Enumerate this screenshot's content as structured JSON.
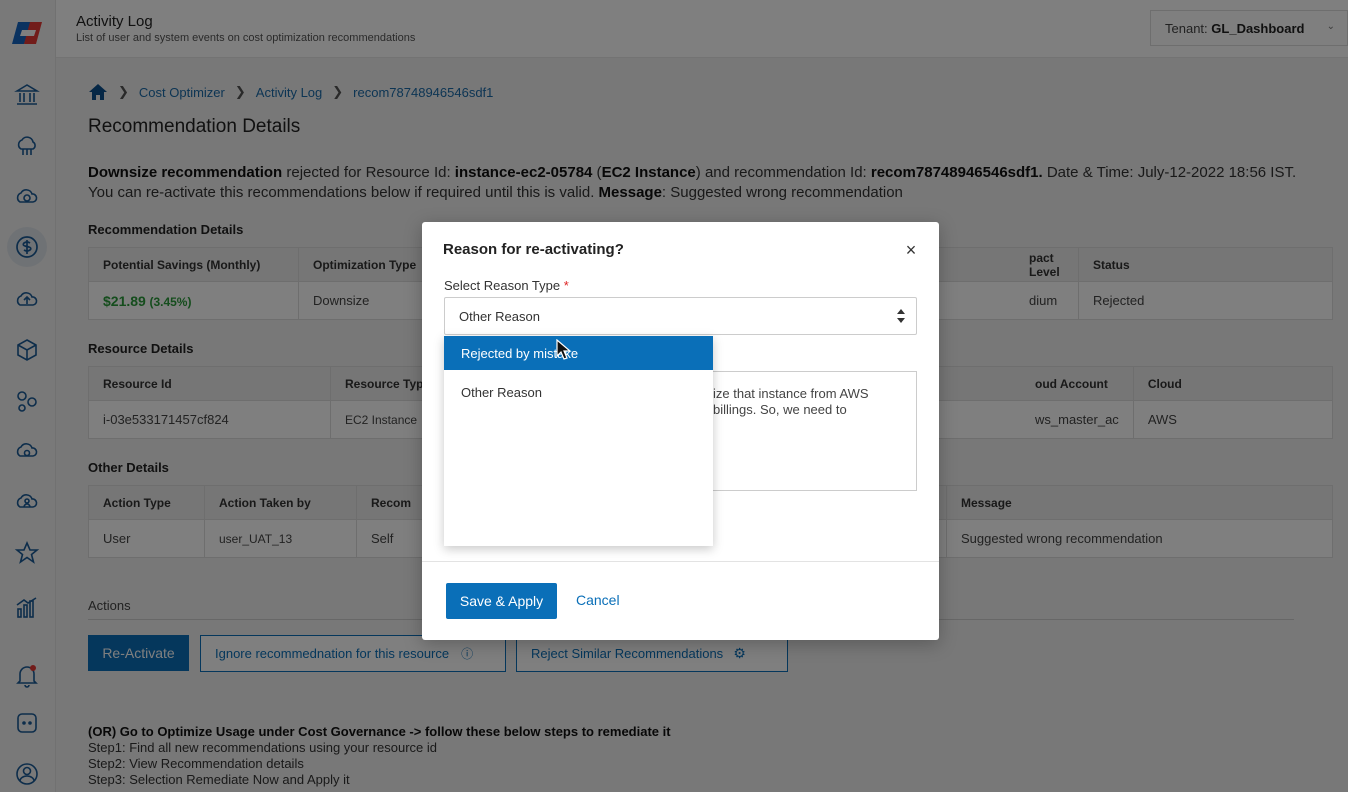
{
  "header": {
    "title": "Activity Log",
    "subtitle": "List of user and system events on cost optimization recommendations",
    "tenant_label": "Tenant:",
    "tenant_value": "GL_Dashboard"
  },
  "breadcrumb": {
    "items": [
      "Cost Optimizer",
      "Activity Log",
      "recom78748946546sdf1"
    ]
  },
  "page": {
    "title": "Recommendation Details",
    "summary": {
      "rec_type": "Downsize recommendation",
      "t1": " rejected for Resource Id: ",
      "resource_id": "instance-ec2-05784",
      "t2": " (",
      "resource_type": "EC2 Instance",
      "t3": ") and recommendation Id: ",
      "rec_id": "recom78748946546sdf1.",
      "t4": " Date & Time: July-12-2022 18:56 IST.",
      "line2": "You can re-activate this recommendations below if required until this is valid. ",
      "message_label": "Message",
      "message_text": ": Suggested wrong recommendation"
    }
  },
  "recommendation_details": {
    "title": "Recommendation Details",
    "headers": [
      "Potential Savings (Monthly)",
      "Optimization Type",
      "pact Level",
      "Status"
    ],
    "savings_value": "$21.89",
    "savings_pct": "(3.45%)",
    "optimization_type": "Downsize",
    "impact_level": "dium",
    "status": "Rejected"
  },
  "resource_details": {
    "title": "Resource Details",
    "headers": [
      "Resource Id",
      "Resource Typ",
      "oud Account",
      "Cloud"
    ],
    "values": [
      "i-03e533171457cf824",
      "EC2 Instance",
      "ws_master_ac",
      "AWS"
    ]
  },
  "other_details": {
    "title": "Other Details",
    "headers": [
      "Action Type",
      "Action Taken by",
      "Recom",
      "Message"
    ],
    "values": [
      "User",
      "user_UAT_13",
      "Self",
      "Suggested wrong recommendation"
    ]
  },
  "actions": {
    "title": "Actions",
    "reactivate": "Re-Activate",
    "ignore": "Ignore recommednation for this resource",
    "reject_similar": "Reject Similar Recommendations"
  },
  "steps": {
    "intro": "(OR) Go to Optimize Usage under Cost Governance -> follow these below steps to remediate it",
    "step1": "Step1: Find all new recommendations using your resource id",
    "step2": "Step2: View Recommendation details",
    "step3": "Step3: Selection Remediate Now and Apply it"
  },
  "modal": {
    "title": "Reason for re-activating?",
    "field_label": "Select Reason Type",
    "required_mark": "*",
    "select_value": "Other Reason",
    "textarea_line1": "ize that instance from AWS",
    "textarea_line2": "billings. So, we need to",
    "dropdown_options": [
      "Rejected by mistake",
      "Other Reason"
    ],
    "save_label": "Save & Apply",
    "cancel_label": "Cancel",
    "close_glyph": "×"
  },
  "colors": {
    "accent": "#0a6fb8",
    "savings": "#2a9a3a",
    "status_rejected": "#d8611a"
  }
}
